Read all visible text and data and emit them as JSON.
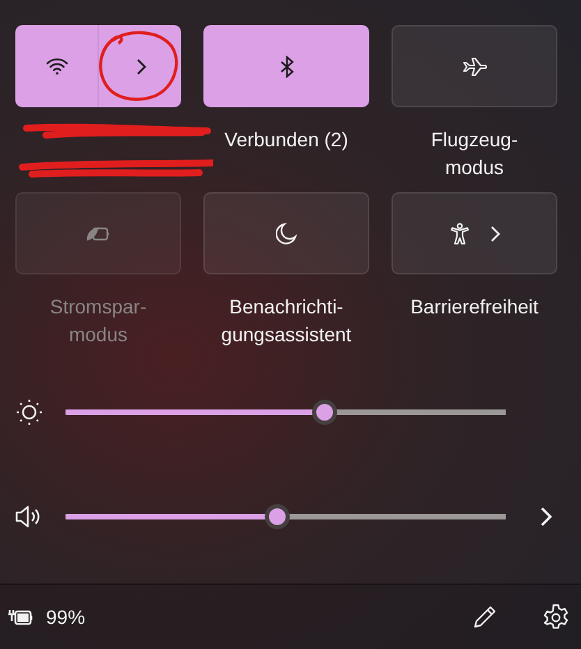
{
  "tiles": [
    {
      "kind": "wifi",
      "on": true,
      "disabled": false,
      "expandable": true,
      "redacted": true,
      "annotated": true
    },
    {
      "kind": "bluetooth",
      "on": true,
      "disabled": false,
      "expandable": false,
      "label": "Verbunden (2)"
    },
    {
      "kind": "airplane",
      "on": false,
      "disabled": false,
      "expandable": false,
      "label": "Flugzeug-\nmodus"
    },
    {
      "kind": "battery-saver",
      "on": false,
      "disabled": true,
      "expandable": false,
      "label": "Stromspar-\nmodus"
    },
    {
      "kind": "focus",
      "on": false,
      "disabled": false,
      "expandable": false,
      "label": "Benachrichti-\ngungsassistent"
    },
    {
      "kind": "accessibility",
      "on": false,
      "disabled": false,
      "expandable": true,
      "label": "Barrierefreiheit"
    }
  ],
  "sliders": [
    {
      "kind": "brightness",
      "level": 0.59,
      "expandable": false
    },
    {
      "kind": "volume",
      "level": 0.48,
      "expandable": true
    }
  ],
  "footer": {
    "battery": "99%"
  }
}
